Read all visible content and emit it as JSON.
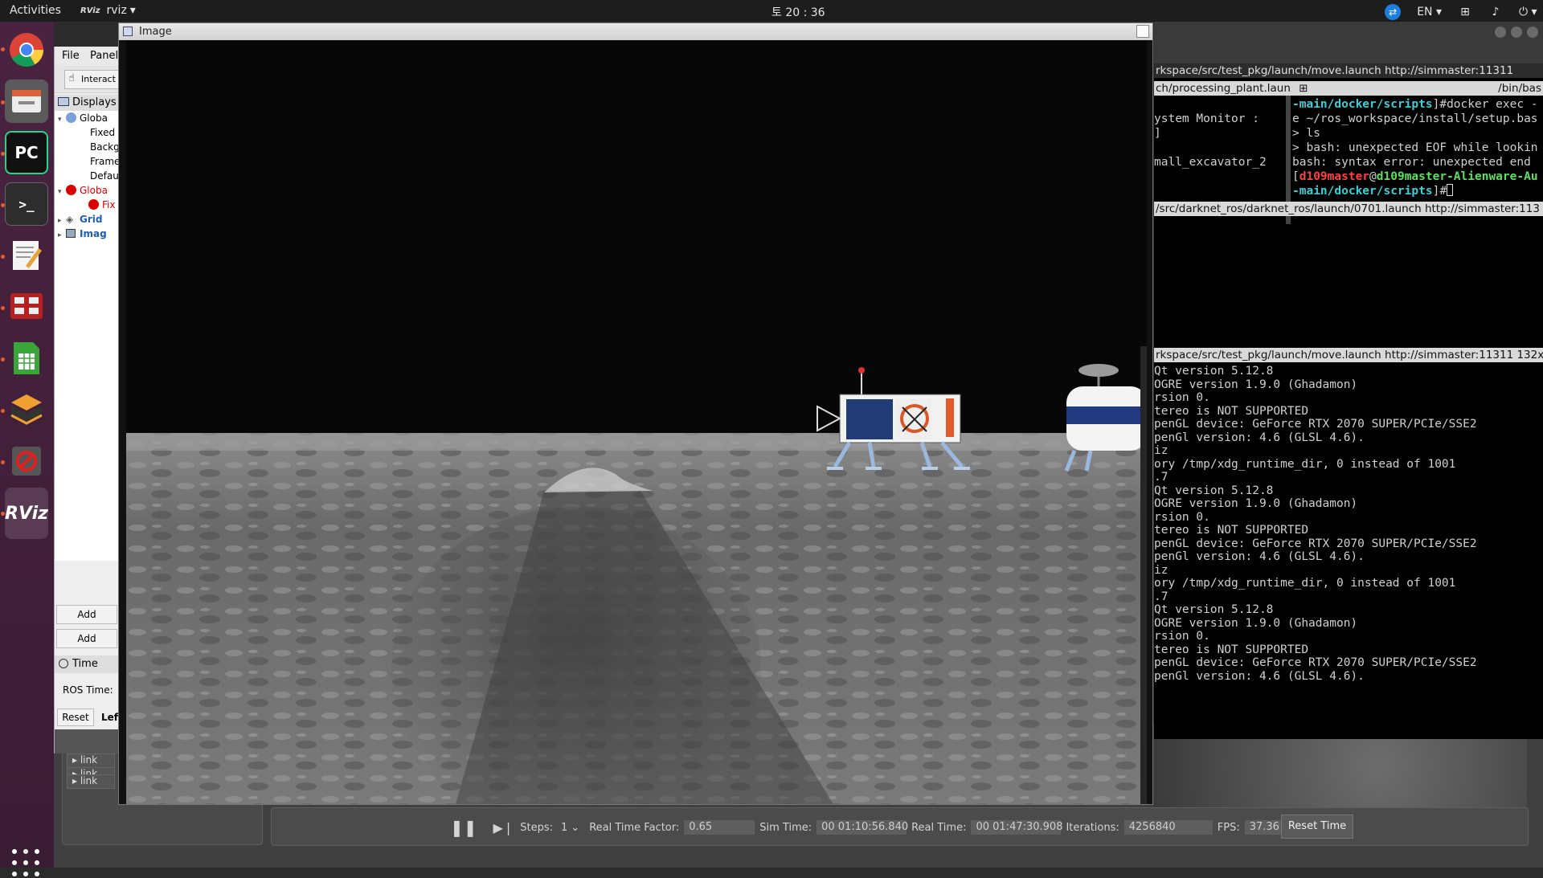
{
  "topbar": {
    "activities": "Activities",
    "app_name": "rviz",
    "app_logo": "RViz",
    "clock": "토 20 : 36",
    "lang": "EN"
  },
  "dock": {
    "items": [
      "chrome-icon",
      "files-icon",
      "pycharm-icon",
      "terminal-icon",
      "text-editor-icon",
      "remmina-icon",
      "spreadsheet-icon",
      "virtualbox-icon",
      "cancel-app-icon",
      "rviz-icon"
    ],
    "pycharm_label": "PC",
    "terminal_label": ">_",
    "rviz_label": "RViz"
  },
  "rviz": {
    "menu_file": "File",
    "menu_panels": "Panel",
    "interact": "Interact",
    "displays_title": "Displays",
    "tree": [
      {
        "label": "Globa",
        "cls": ""
      },
      {
        "label": "Fixed",
        "cls": ""
      },
      {
        "label": "Backg",
        "cls": ""
      },
      {
        "label": "Frame",
        "cls": ""
      },
      {
        "label": "Defau",
        "cls": ""
      },
      {
        "label": "Globa",
        "cls": "err"
      },
      {
        "label": "Fix",
        "cls": "err"
      },
      {
        "label": "Grid",
        "cls": "blue"
      },
      {
        "label": "Imag",
        "cls": "blue"
      }
    ],
    "add_1": "Add",
    "add_2": "Add",
    "time_title": "Time",
    "ros_time": "ROS Time:",
    "reset": "Reset",
    "left": "Lef"
  },
  "gazebo": {
    "links": [
      "link",
      "link",
      "link"
    ],
    "steps_label": "Steps:",
    "steps_value": "1",
    "rtf_label": "Real Time Factor:",
    "rtf_value": "0.65",
    "sim_label": "Sim Time:",
    "sim_value": "00 01:10:56.840",
    "real_label": "Real Time:",
    "real_value": "00 01:47:30.908",
    "iter_label": "Iterations:",
    "iter_value": "4256840",
    "fps_label": "FPS:",
    "fps_value": "37.36",
    "reset_time": "Reset Time"
  },
  "terminal": {
    "title1": "rkspace/src/test_pkg/launch/move.launch http://simmaster:11311",
    "title2a": "ch/processing_plant.laun",
    "title2b": "/bin/bas",
    "left_lines": [
      "ystem Monitor :",
      "]",
      "",
      "mall_excavator_2"
    ],
    "right_lines": [
      {
        "cls": "cyan",
        "text": "-main/docker/scripts",
        "rest": "]#docker exec -"
      },
      {
        "cls": "",
        "text": "e ~/ros_workspace/install/setup.bas",
        "rest": ""
      },
      {
        "cls": "",
        "text": "> ls",
        "rest": ""
      },
      {
        "cls": "",
        "text": "> bash: unexpected EOF while lookin",
        "rest": ""
      },
      {
        "cls": "",
        "text": "bash: syntax error: unexpected end",
        "rest": ""
      }
    ],
    "prompt_user": "d109master",
    "prompt_at": "@",
    "prompt_host": "d109master-Alienware-Au",
    "prompt_dir": "-main/docker/scripts",
    "prompt_end": "]#",
    "title3": "/src/darknet_ros/darknet_ros/launch/0701.launch http://simmaster:113",
    "title4": "rkspace/src/test_pkg/launch/move.launch http://simmaster:11311 132x2",
    "log": [
      "Qt version 5.12.8",
      "OGRE version 1.9.0 (Ghadamon)",
      "rsion 0.",
      "tereo is NOT SUPPORTED",
      "penGL device: GeForce RTX 2070 SUPER/PCIe/SSE2",
      "penGl version: 4.6 (GLSL 4.6).",
      "iz",
      "ory /tmp/xdg_runtime_dir, 0 instead of 1001",
      ".7",
      "Qt version 5.12.8",
      "OGRE version 1.9.0 (Ghadamon)",
      "rsion 0.",
      "tereo is NOT SUPPORTED",
      "penGL device: GeForce RTX 2070 SUPER/PCIe/SSE2",
      "penGl version: 4.6 (GLSL 4.6).",
      "iz",
      "ory /tmp/xdg_runtime_dir, 0 instead of 1001",
      ".7",
      "Qt version 5.12.8",
      "OGRE version 1.9.0 (Ghadamon)",
      "rsion 0.",
      "tereo is NOT SUPPORTED",
      "penGL device: GeForce RTX 2070 SUPER/PCIe/SSE2",
      "penGl version: 4.6 (GLSL 4.6)."
    ]
  },
  "image_window": {
    "title": "Image"
  }
}
